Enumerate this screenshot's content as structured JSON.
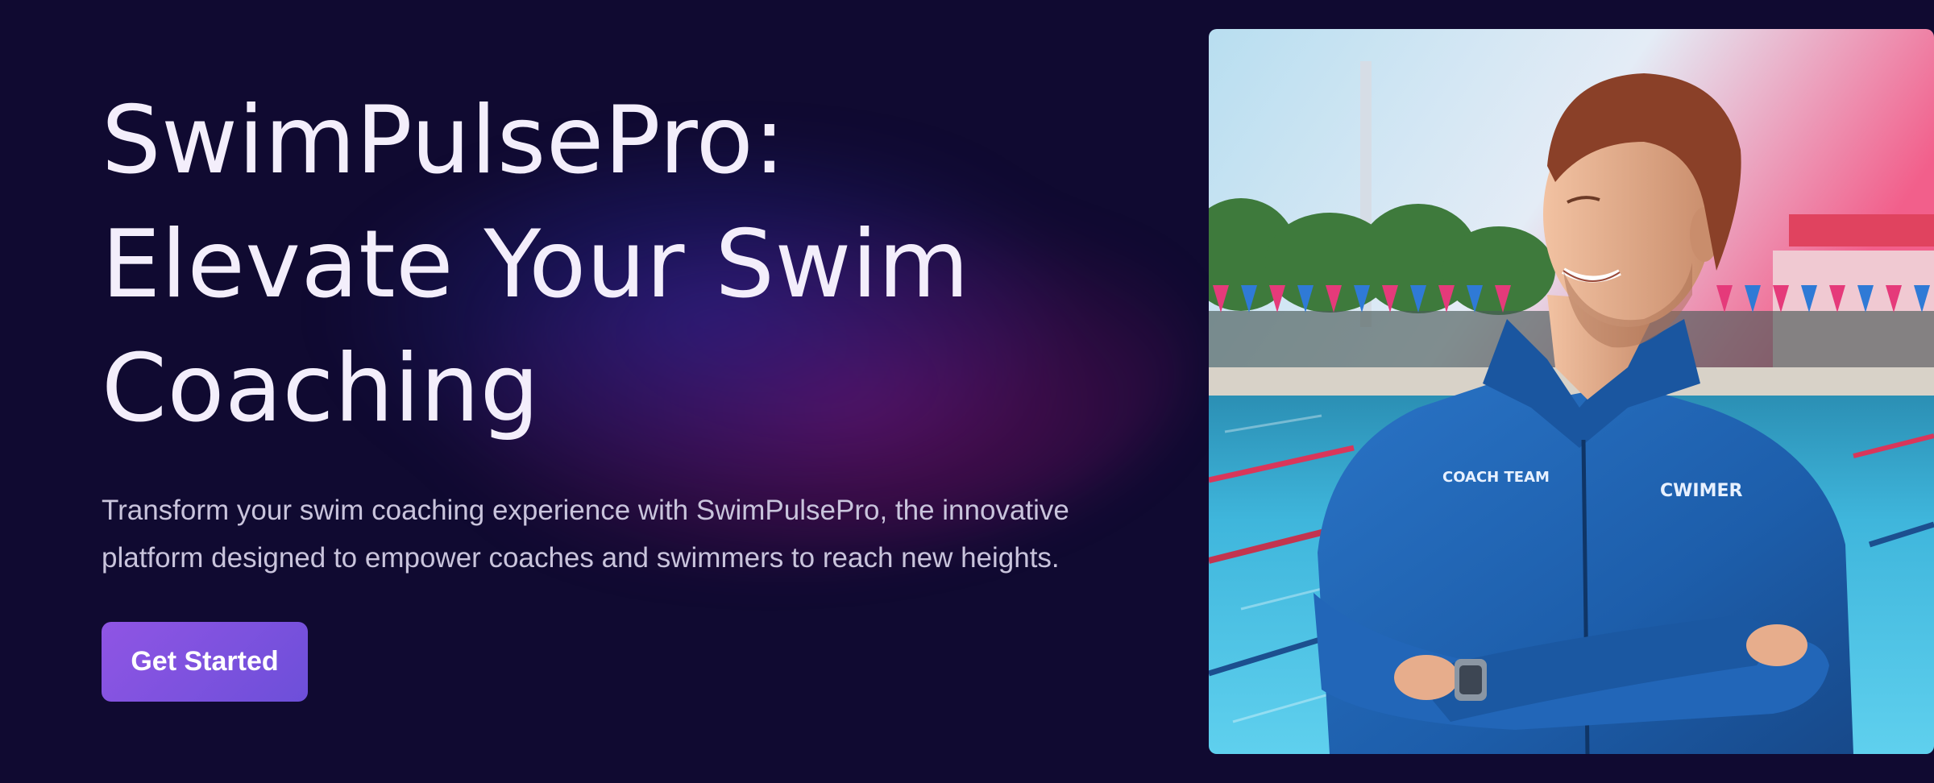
{
  "hero": {
    "headline_lines": [
      "SwimPulsePro:",
      "Elevate Your Swim",
      "Coaching"
    ],
    "description_lines": [
      "Transform your swim coaching experience with SwimPulsePro, the innovative",
      "platform designed to empower coaches and swimmers to reach new heights."
    ],
    "cta_label": "Get Started"
  },
  "photo": {
    "jacket_text_left": "COACH TEAM",
    "jacket_text_right": "CWIMER"
  },
  "colors": {
    "background": "#100a31",
    "headline": "#f3eefb",
    "body_text": "#c9c4dc",
    "cta_start": "#8f55e4",
    "cta_end": "#6d4fd9",
    "jacket": "#1f63b3",
    "pool": "#3fb6dc"
  }
}
